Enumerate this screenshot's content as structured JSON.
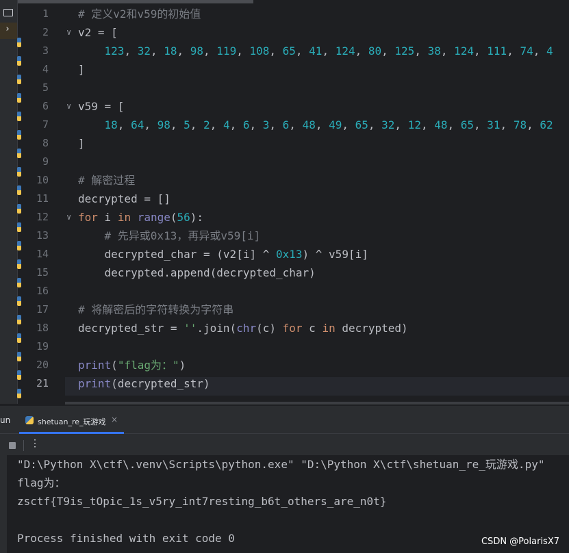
{
  "editor": {
    "project_strip": {
      "icons": [
        "folder-icon",
        "chevron-right-icon",
        "folder-icon"
      ]
    },
    "line_numbers": [
      "1",
      "2",
      "3",
      "4",
      "5",
      "6",
      "7",
      "8",
      "9",
      "10",
      "11",
      "12",
      "13",
      "14",
      "15",
      "16",
      "17",
      "18",
      "19",
      "20",
      "21"
    ],
    "current_line": "21",
    "lines": [
      [
        {
          "t": "# 定义v2和v59的初始值",
          "c": "cm"
        }
      ],
      [
        {
          "t": "v2 = [",
          "c": ""
        }
      ],
      [
        {
          "t": "    ",
          "c": ""
        },
        {
          "t": "123",
          "c": "num"
        },
        {
          "t": ", ",
          "c": ""
        },
        {
          "t": "32",
          "c": "num"
        },
        {
          "t": ", ",
          "c": ""
        },
        {
          "t": "18",
          "c": "num"
        },
        {
          "t": ", ",
          "c": ""
        },
        {
          "t": "98",
          "c": "num"
        },
        {
          "t": ", ",
          "c": ""
        },
        {
          "t": "119",
          "c": "num"
        },
        {
          "t": ", ",
          "c": ""
        },
        {
          "t": "108",
          "c": "num"
        },
        {
          "t": ", ",
          "c": ""
        },
        {
          "t": "65",
          "c": "num"
        },
        {
          "t": ", ",
          "c": ""
        },
        {
          "t": "41",
          "c": "num"
        },
        {
          "t": ", ",
          "c": ""
        },
        {
          "t": "124",
          "c": "num"
        },
        {
          "t": ", ",
          "c": ""
        },
        {
          "t": "80",
          "c": "num"
        },
        {
          "t": ", ",
          "c": ""
        },
        {
          "t": "125",
          "c": "num"
        },
        {
          "t": ", ",
          "c": ""
        },
        {
          "t": "38",
          "c": "num"
        },
        {
          "t": ", ",
          "c": ""
        },
        {
          "t": "124",
          "c": "num"
        },
        {
          "t": ", ",
          "c": ""
        },
        {
          "t": "111",
          "c": "num"
        },
        {
          "t": ", ",
          "c": ""
        },
        {
          "t": "74",
          "c": "num"
        },
        {
          "t": ", ",
          "c": ""
        },
        {
          "t": "4",
          "c": "num"
        }
      ],
      [
        {
          "t": "]",
          "c": ""
        }
      ],
      [],
      [
        {
          "t": "v59 = [",
          "c": ""
        }
      ],
      [
        {
          "t": "    ",
          "c": ""
        },
        {
          "t": "18",
          "c": "num"
        },
        {
          "t": ", ",
          "c": ""
        },
        {
          "t": "64",
          "c": "num"
        },
        {
          "t": ", ",
          "c": ""
        },
        {
          "t": "98",
          "c": "num"
        },
        {
          "t": ", ",
          "c": ""
        },
        {
          "t": "5",
          "c": "num"
        },
        {
          "t": ", ",
          "c": ""
        },
        {
          "t": "2",
          "c": "num"
        },
        {
          "t": ", ",
          "c": ""
        },
        {
          "t": "4",
          "c": "num"
        },
        {
          "t": ", ",
          "c": ""
        },
        {
          "t": "6",
          "c": "num"
        },
        {
          "t": ", ",
          "c": ""
        },
        {
          "t": "3",
          "c": "num"
        },
        {
          "t": ", ",
          "c": ""
        },
        {
          "t": "6",
          "c": "num"
        },
        {
          "t": ", ",
          "c": ""
        },
        {
          "t": "48",
          "c": "num"
        },
        {
          "t": ", ",
          "c": ""
        },
        {
          "t": "49",
          "c": "num"
        },
        {
          "t": ", ",
          "c": ""
        },
        {
          "t": "65",
          "c": "num"
        },
        {
          "t": ", ",
          "c": ""
        },
        {
          "t": "32",
          "c": "num"
        },
        {
          "t": ", ",
          "c": ""
        },
        {
          "t": "12",
          "c": "num"
        },
        {
          "t": ", ",
          "c": ""
        },
        {
          "t": "48",
          "c": "num"
        },
        {
          "t": ", ",
          "c": ""
        },
        {
          "t": "65",
          "c": "num"
        },
        {
          "t": ", ",
          "c": ""
        },
        {
          "t": "31",
          "c": "num"
        },
        {
          "t": ", ",
          "c": ""
        },
        {
          "t": "78",
          "c": "num"
        },
        {
          "t": ", ",
          "c": ""
        },
        {
          "t": "62",
          "c": "num"
        }
      ],
      [
        {
          "t": "]",
          "c": ""
        }
      ],
      [],
      [
        {
          "t": "# 解密过程",
          "c": "cm"
        }
      ],
      [
        {
          "t": "decrypted = []",
          "c": ""
        }
      ],
      [
        {
          "t": "for",
          "c": "kw"
        },
        {
          "t": " i ",
          "c": ""
        },
        {
          "t": "in",
          "c": "kw"
        },
        {
          "t": " ",
          "c": ""
        },
        {
          "t": "range",
          "c": "bi"
        },
        {
          "t": "(",
          "c": ""
        },
        {
          "t": "56",
          "c": "num"
        },
        {
          "t": "):",
          "c": ""
        }
      ],
      [
        {
          "t": "    ",
          "c": ""
        },
        {
          "t": "# 先异或0x13，再异或v59[i]",
          "c": "cm"
        }
      ],
      [
        {
          "t": "    decrypted_char = (v2[i] ^ ",
          "c": ""
        },
        {
          "t": "0x13",
          "c": "num"
        },
        {
          "t": ") ^ v59[i]",
          "c": ""
        }
      ],
      [
        {
          "t": "    decrypted.append(decrypted_char)",
          "c": ""
        }
      ],
      [],
      [
        {
          "t": "# 将解密后的字符转换为字符串",
          "c": "cm"
        }
      ],
      [
        {
          "t": "decrypted_str = ",
          "c": ""
        },
        {
          "t": "''",
          "c": "str"
        },
        {
          "t": ".join(",
          "c": ""
        },
        {
          "t": "chr",
          "c": "bi"
        },
        {
          "t": "(c) ",
          "c": ""
        },
        {
          "t": "for",
          "c": "kw"
        },
        {
          "t": " c ",
          "c": ""
        },
        {
          "t": "in",
          "c": "kw"
        },
        {
          "t": " decrypted)",
          "c": ""
        }
      ],
      [],
      [
        {
          "t": "print",
          "c": "bi"
        },
        {
          "t": "(",
          "c": ""
        },
        {
          "t": "\"flag为：\"",
          "c": "str"
        },
        {
          "t": ")",
          "c": ""
        }
      ],
      [
        {
          "t": "print",
          "c": "bi"
        },
        {
          "t": "(decrypted_str)",
          "c": ""
        }
      ]
    ],
    "fold_markers": [
      {
        "line": "2",
        "icon": "fold-chevron-icon"
      },
      {
        "line": "6",
        "icon": "fold-chevron-icon"
      },
      {
        "line": "12",
        "icon": "fold-chevron-icon"
      }
    ]
  },
  "run": {
    "tool_label": "un",
    "tab": {
      "label": "shetuan_re_玩游戏",
      "icon": "python-file-icon",
      "close": "×"
    },
    "toolbar": {
      "stop_icon": "stop-icon",
      "more": "⋮"
    },
    "console": [
      "\"D:\\Python X\\ctf\\.venv\\Scripts\\python.exe\" \"D:\\Python X\\ctf\\shetuan_re_玩游戏.py\"",
      "flag为：",
      "zsctf{T9is_tOpic_1s_v5ry_int7resting_b6t_others_are_n0t}",
      "",
      "Process finished with exit code 0"
    ]
  },
  "watermark": "CSDN @PolarisX7",
  "colors": {
    "background": "#1e1f22",
    "comment": "#7a7e85",
    "number": "#2aacb8",
    "keyword": "#cf8e6d",
    "builtin": "#8888c6",
    "string": "#6aab73",
    "accent": "#3574f0"
  }
}
